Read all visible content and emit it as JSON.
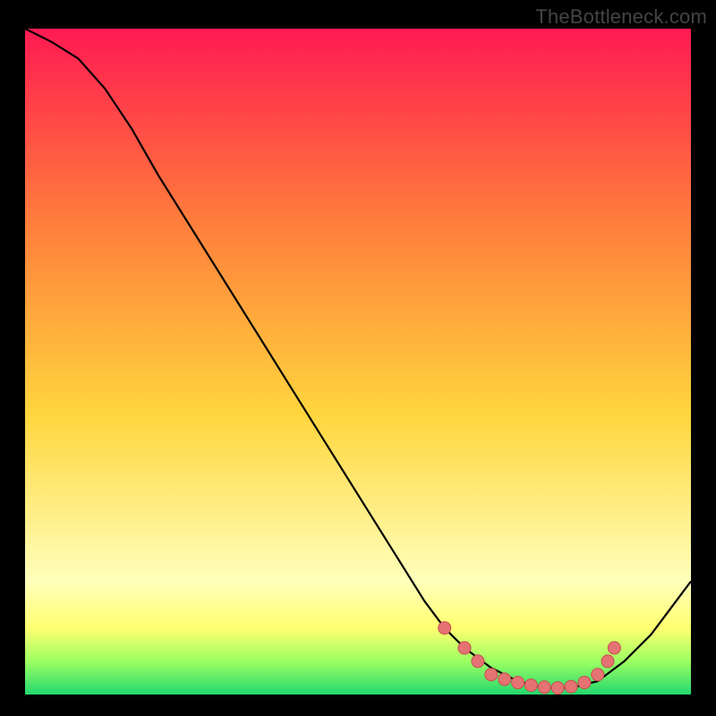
{
  "watermark": "TheBottleneck.com",
  "colors": {
    "bg_black": "#000000",
    "grad_top": "#ff1a52",
    "grad_mid_upper": "#ff7a3c",
    "grad_mid": "#ffd63d",
    "grad_band_light": "#ffffbb",
    "grad_green1": "#9cff62",
    "grad_green2": "#23d86f",
    "curve": "#000000",
    "dot_fill": "#e57373",
    "dot_stroke": "#c94e4e"
  },
  "chart_data": {
    "type": "line",
    "title": "",
    "xlabel": "",
    "ylabel": "",
    "xlim": [
      0,
      100
    ],
    "ylim": [
      0,
      100
    ],
    "x": [
      0,
      4,
      8,
      12,
      16,
      20,
      25,
      30,
      35,
      40,
      45,
      50,
      55,
      60,
      63,
      66,
      70,
      74,
      78,
      82,
      86,
      90,
      94,
      100
    ],
    "y": [
      100,
      98,
      95.5,
      91,
      85,
      78,
      70,
      62,
      54,
      46,
      38,
      30,
      22,
      14,
      10,
      7,
      4,
      2,
      1,
      1,
      2,
      5,
      9,
      17
    ],
    "dots": [
      {
        "x": 63,
        "y": 10
      },
      {
        "x": 66,
        "y": 7
      },
      {
        "x": 68,
        "y": 5
      },
      {
        "x": 70,
        "y": 3
      },
      {
        "x": 72,
        "y": 2.3
      },
      {
        "x": 74,
        "y": 1.8
      },
      {
        "x": 76,
        "y": 1.4
      },
      {
        "x": 78,
        "y": 1.1
      },
      {
        "x": 80,
        "y": 1.0
      },
      {
        "x": 82,
        "y": 1.2
      },
      {
        "x": 84,
        "y": 1.8
      },
      {
        "x": 86,
        "y": 3
      },
      {
        "x": 87.5,
        "y": 5
      },
      {
        "x": 88.5,
        "y": 7
      }
    ]
  }
}
